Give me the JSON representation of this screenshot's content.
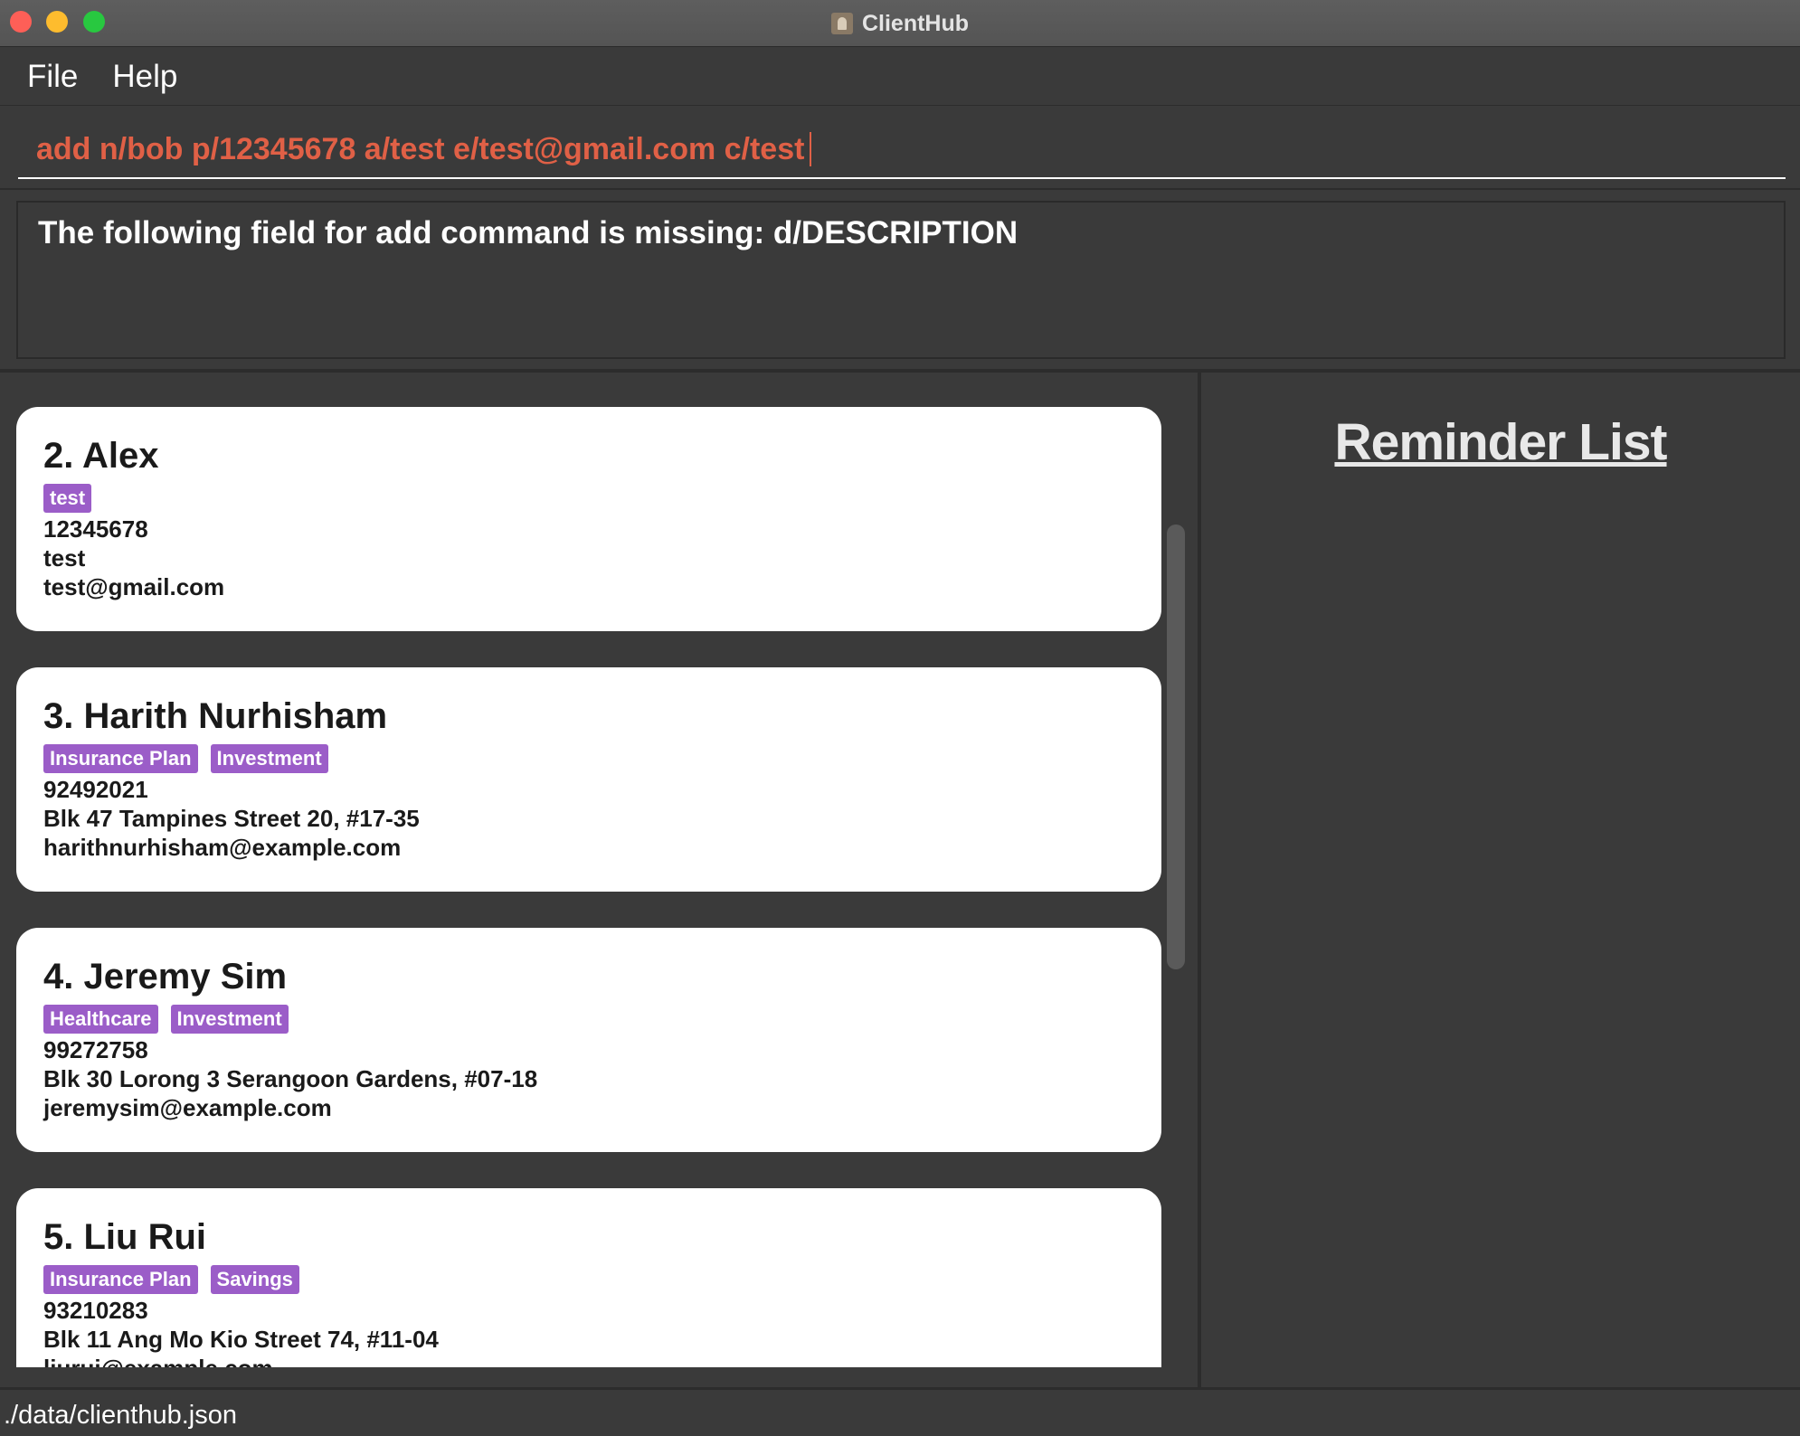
{
  "window": {
    "title": "ClientHub"
  },
  "menu": {
    "file": "File",
    "help": "Help"
  },
  "command": {
    "value": "add n/bob p/12345678 a/test e/test@gmail.com c/test"
  },
  "result": {
    "message": "The following field for add command is missing: d/DESCRIPTION"
  },
  "persons": [
    {
      "name": "2. Alex",
      "tags": [
        "test"
      ],
      "phone": "12345678",
      "address": "test",
      "email": "test@gmail.com"
    },
    {
      "name": "3. Harith Nurhisham",
      "tags": [
        "Insurance Plan",
        "Investment"
      ],
      "phone": "92492021",
      "address": "Blk 47 Tampines Street 20, #17-35",
      "email": "harithnurhisham@example.com"
    },
    {
      "name": "4. Jeremy Sim",
      "tags": [
        "Healthcare",
        "Investment"
      ],
      "phone": "99272758",
      "address": "Blk 30 Lorong 3 Serangoon Gardens, #07-18",
      "email": "jeremysim@example.com"
    },
    {
      "name": "5. Liu Rui",
      "tags": [
        "Insurance Plan",
        "Savings"
      ],
      "phone": "93210283",
      "address": "Blk 11 Ang Mo Kio Street 74, #11-04",
      "email": "liurui@example.com"
    }
  ],
  "reminders": {
    "title": "Reminder List"
  },
  "status": {
    "file_path": "./data/clienthub.json"
  },
  "colors": {
    "background": "#3a3a3a",
    "command_text": "#e06046",
    "tag": "#9b5dc8",
    "card": "#ffffff"
  }
}
